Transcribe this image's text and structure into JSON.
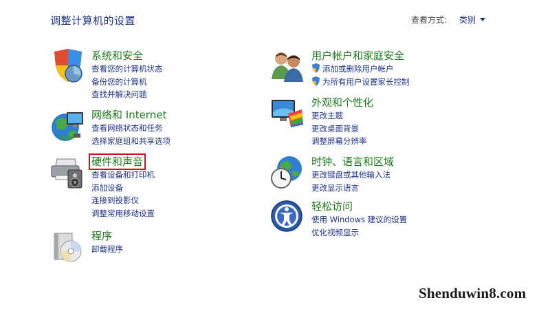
{
  "page": {
    "title": "调整计算机的设置"
  },
  "view_by": {
    "label": "查看方式:",
    "value": "类别"
  },
  "categories": [
    {
      "title": "系统和安全",
      "icon": "system-security-icon",
      "links": [
        "查看您的计算机状态",
        "备份您的计算机",
        "查找并解决问题"
      ]
    },
    {
      "title": "网络和 Internet",
      "icon": "network-internet-icon",
      "links": [
        "查看网络状态和任务",
        "选择家庭组和共享选项"
      ]
    },
    {
      "title": "硬件和声音",
      "icon": "hardware-sound-icon",
      "highlighted": true,
      "links": [
        "查看设备和打印机",
        "添加设备",
        "连接到投影仪",
        "调整常用移动设置"
      ]
    },
    {
      "title": "程序",
      "icon": "programs-icon",
      "links": [
        "卸载程序"
      ]
    },
    {
      "title": "用户帐户和家庭安全",
      "icon": "user-accounts-icon",
      "links": [
        "添加或删除用户帐户",
        "为所有用户设置家长控制"
      ]
    },
    {
      "title": "外观和个性化",
      "icon": "appearance-icon",
      "links": [
        "更改主题",
        "更改桌面背景",
        "调整屏幕分辨率"
      ]
    },
    {
      "title": "时钟、语言和区域",
      "icon": "clock-language-region-icon",
      "links": [
        "更改键盘或其他输入法",
        "更改显示语言"
      ]
    },
    {
      "title": "轻松访问",
      "icon": "ease-of-access-icon",
      "links": [
        "使用 Windows 建议的设置",
        "优化视频显示"
      ]
    }
  ],
  "watermark": "Shenduwin8.com",
  "colors": {
    "category_title": "#1b7a1b",
    "link": "#1e3287",
    "highlight_box": "#c8161d"
  }
}
